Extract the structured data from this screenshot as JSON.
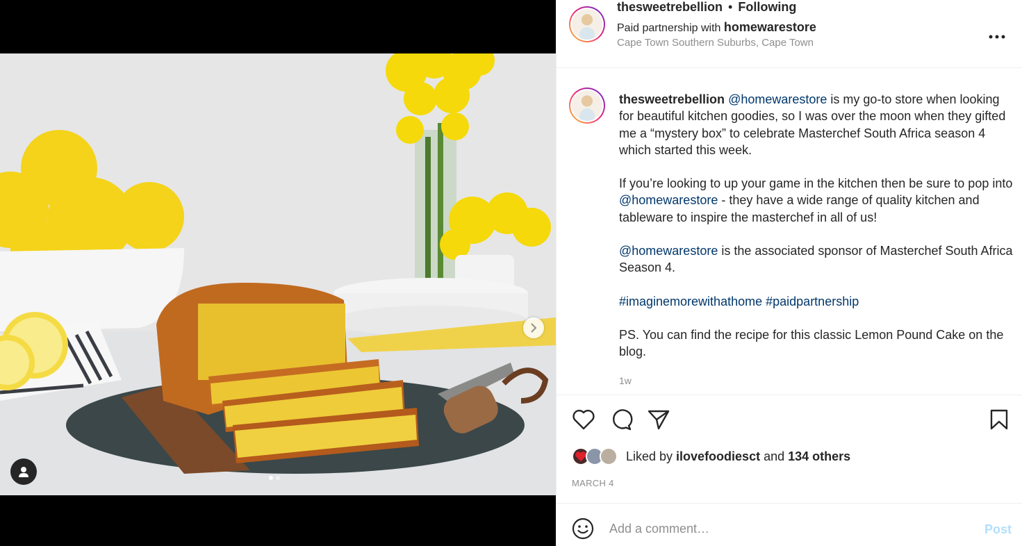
{
  "header": {
    "username": "thesweetrebellion",
    "separator": "•",
    "follow_status": "Following",
    "partnership_prefix": "Paid partnership with",
    "partner": "homewarestore",
    "location": "Cape Town Southern Suburbs, Cape Town",
    "more_icon": "more-horizontal-icon"
  },
  "media": {
    "carousel_total": 2,
    "carousel_active": 1
  },
  "caption": {
    "username": "thesweetrebellion",
    "p1_mention": "@homewarestore",
    "p1_text": " is my go-to store when looking for beautiful kitchen goodies, so I was over the moon when they gifted me a “mystery box” to celebrate Masterchef South Africa season 4 which started this week.",
    "p2_text_a": "If you’re looking to up your game in the kitchen then be sure to pop into ",
    "p2_mention": "@homewarestore",
    "p2_text_b": " - they have a wide range of quality kitchen and tableware to inspire the masterchef in all of us!",
    "p3_mention": "@homewarestore",
    "p3_text": " is the associated sponsor of Masterchef South Africa Season 4.",
    "hashtag1": "#imaginemorewithathome",
    "hashtag2": "#paidpartnership",
    "p5_text": "PS. You can find the recipe for this classic Lemon Pound Cake on the blog.",
    "time": "1w"
  },
  "likes": {
    "prefix": "Liked by ",
    "user": "ilovefoodiesct",
    "middle": " and ",
    "others": "134 others"
  },
  "date": "MARCH 4",
  "comment": {
    "placeholder": "Add a comment…",
    "post_label": "Post"
  },
  "colors": {
    "link": "#00376b",
    "muted": "#8e8e8e",
    "post_disabled": "#b2dffc",
    "text": "#262626"
  }
}
